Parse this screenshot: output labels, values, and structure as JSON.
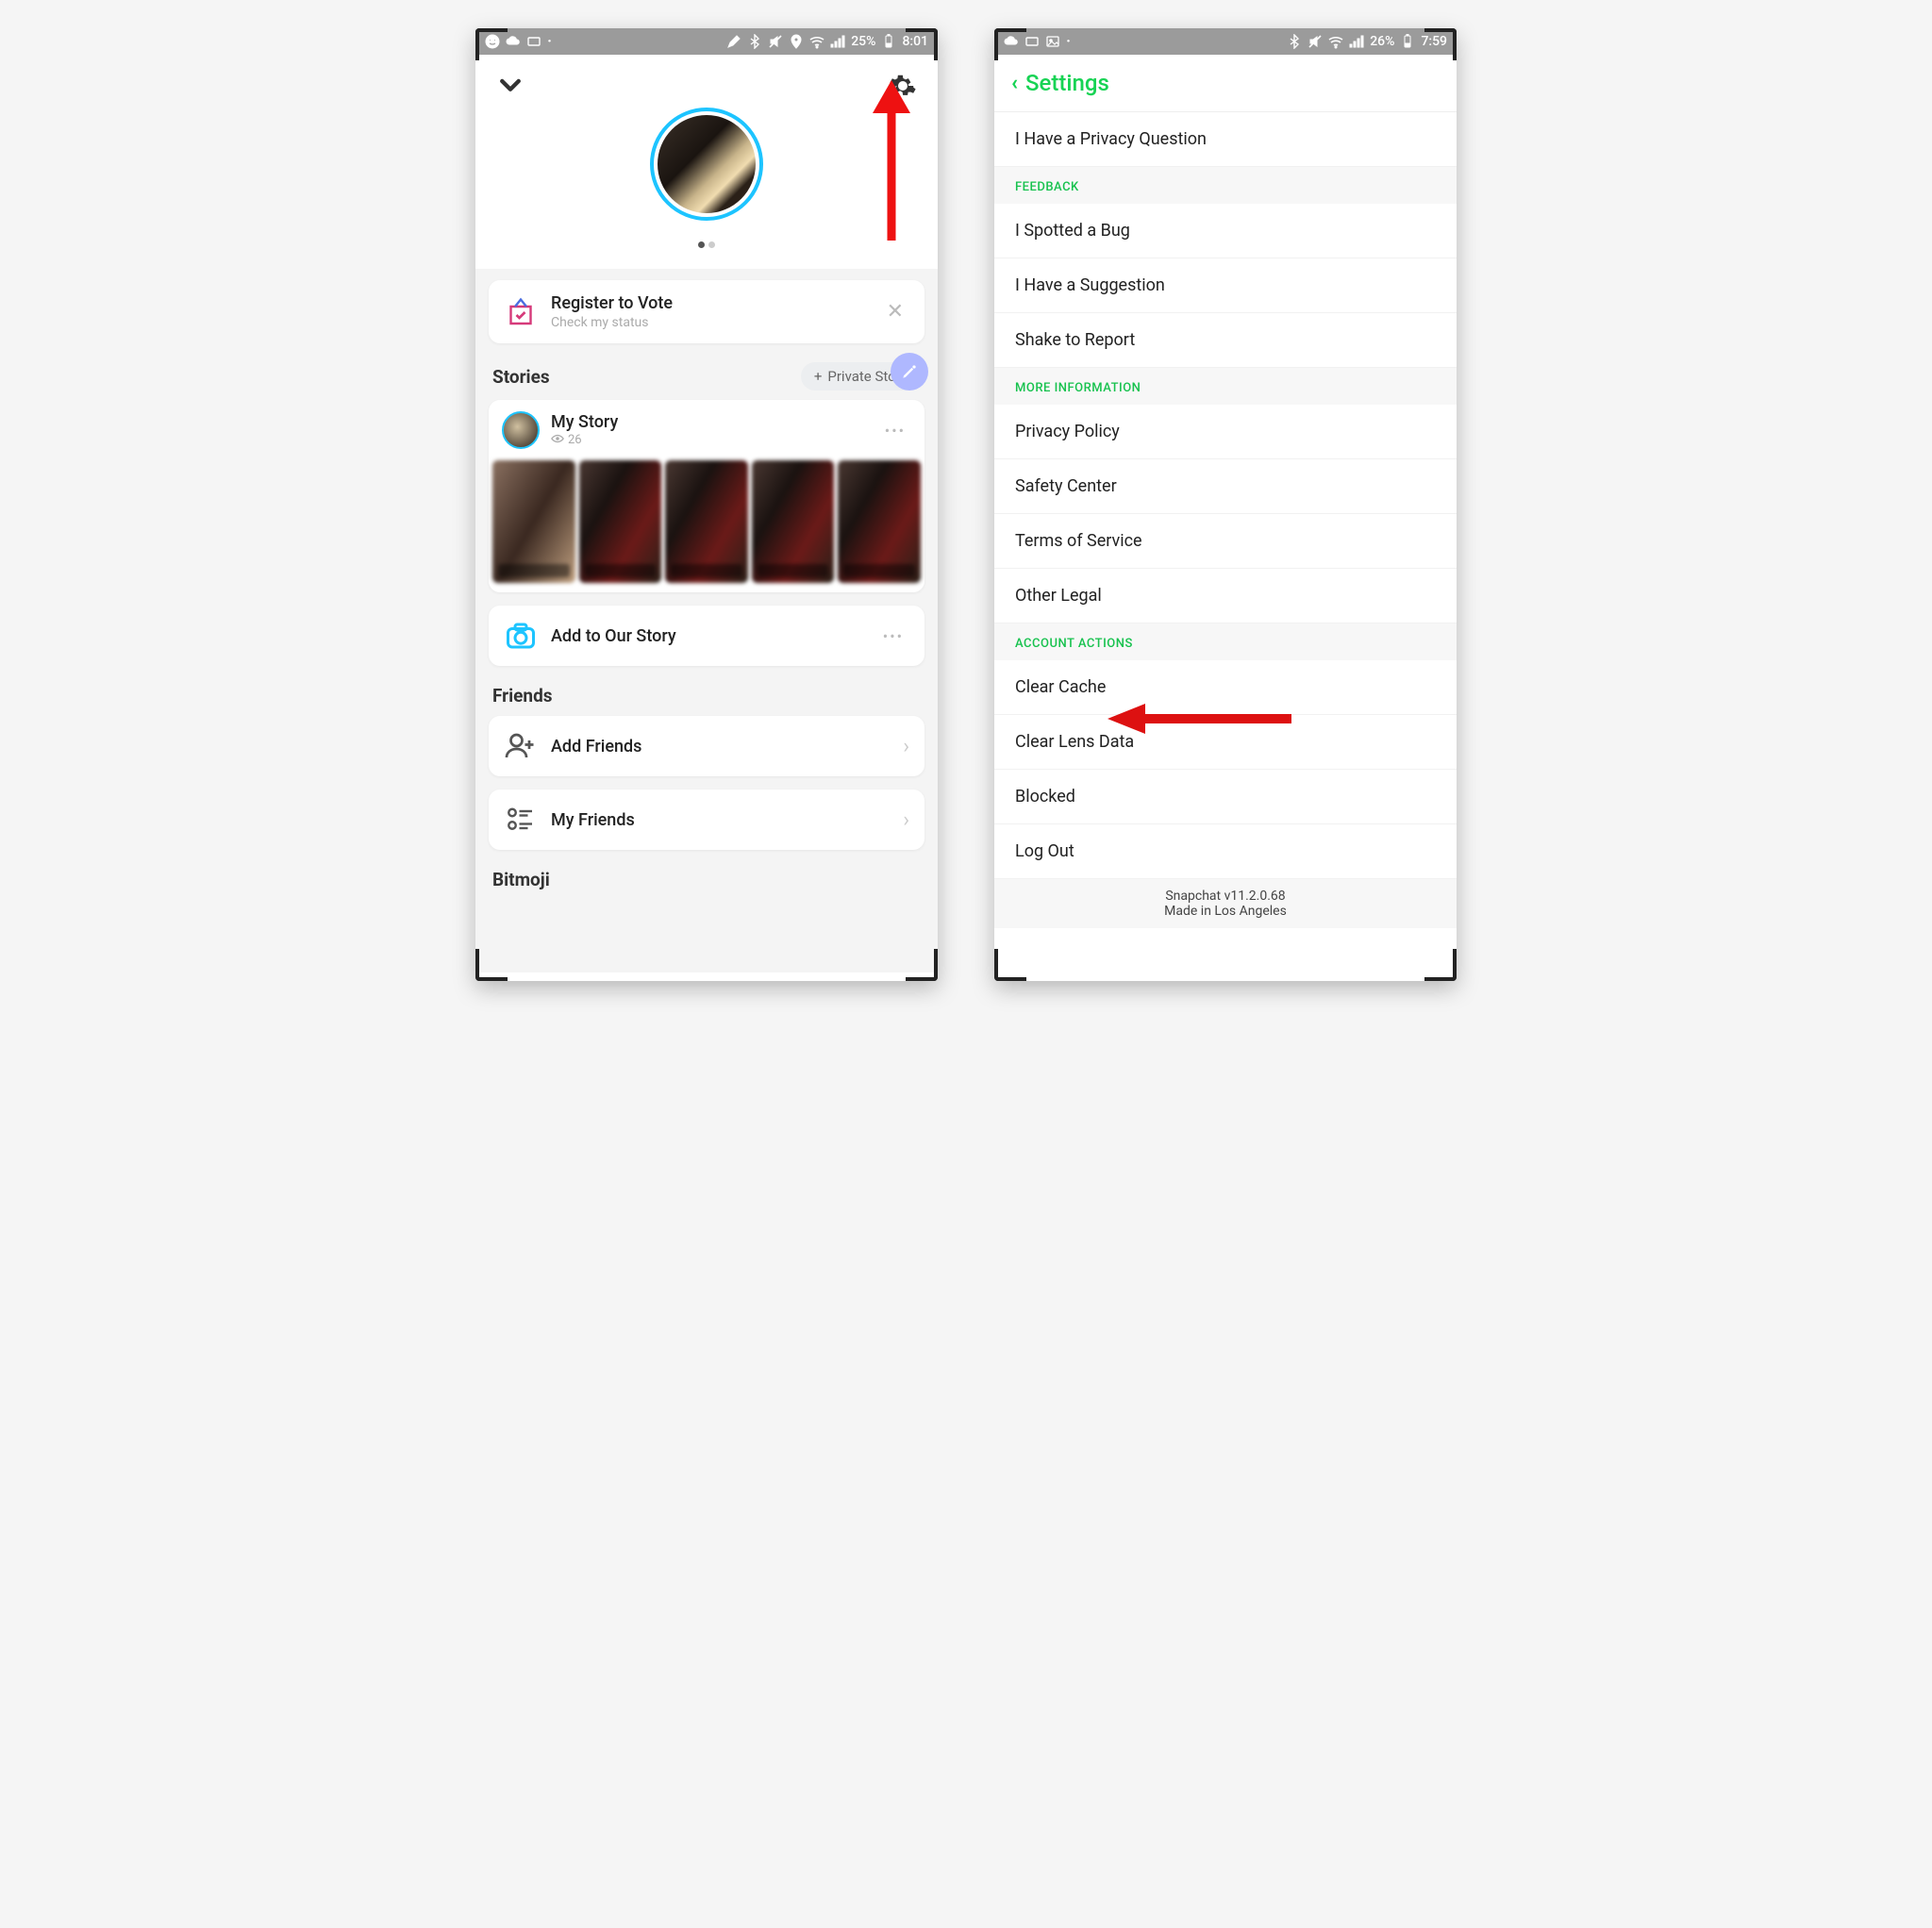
{
  "phone1": {
    "statusbar": {
      "battery": "25%",
      "time": "8:01"
    },
    "vote": {
      "title": "Register to Vote",
      "sub": "Check my status"
    },
    "stories_title": "Stories",
    "private_story_btn": "Private Story",
    "my_story": {
      "name": "My Story",
      "views": "26"
    },
    "add_our_story": "Add to Our Story",
    "friends_title": "Friends",
    "add_friends": "Add Friends",
    "my_friends": "My Friends",
    "bitmoji_title": "Bitmoji"
  },
  "phone2": {
    "statusbar": {
      "battery": "26%",
      "time": "7:59"
    },
    "title": "Settings",
    "items": {
      "privacy_q": "I Have a Privacy Question",
      "grp_feedback": "FEEDBACK",
      "bug": "I Spotted a Bug",
      "suggestion": "I Have a Suggestion",
      "shake": "Shake to Report",
      "grp_more": "MORE INFORMATION",
      "privacy_policy": "Privacy Policy",
      "safety": "Safety Center",
      "tos": "Terms of Service",
      "other_legal": "Other Legal",
      "grp_account": "ACCOUNT ACTIONS",
      "clear_cache": "Clear Cache",
      "clear_lens": "Clear Lens Data",
      "blocked": "Blocked",
      "logout": "Log Out"
    },
    "footer": {
      "version": "Snapchat v11.2.0.68",
      "made_in": "Made in Los Angeles"
    }
  }
}
